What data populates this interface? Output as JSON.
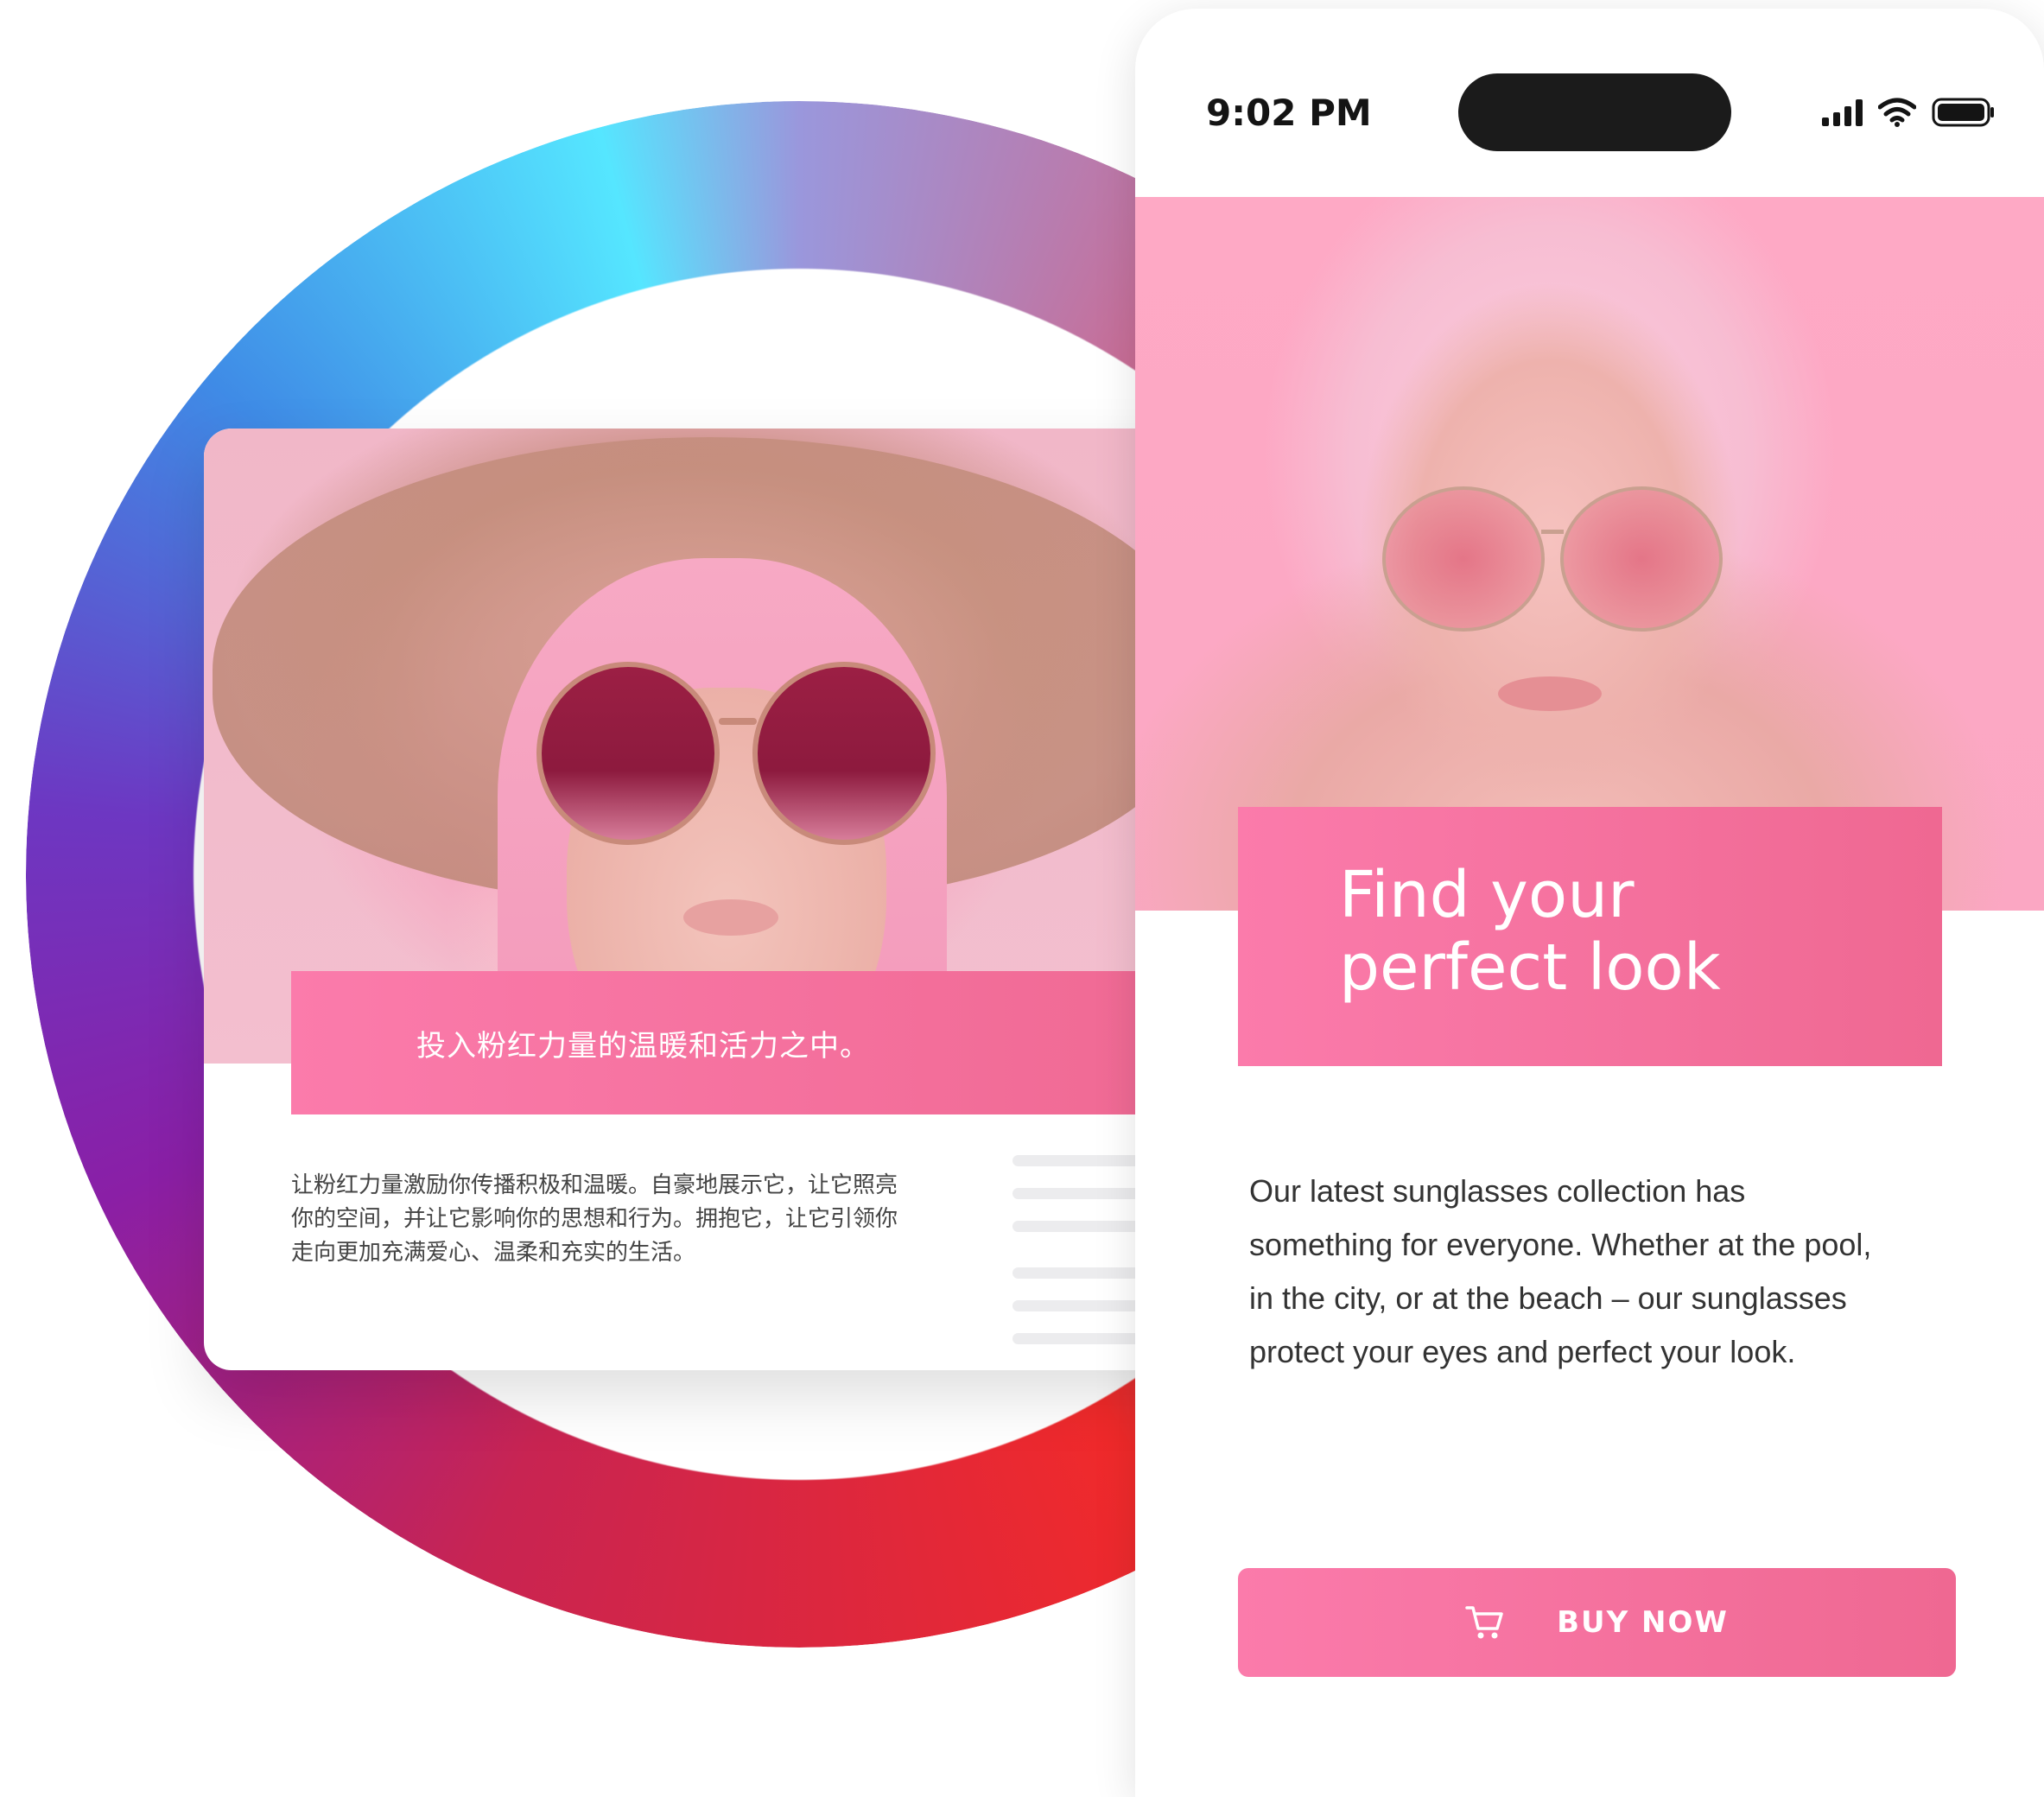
{
  "left_card": {
    "banner_text": "投入粉红力量的温暖和活力之中。",
    "body_lines": [
      "让粉红力量激励你传播积极和温暖。自豪地展示它，让它照亮",
      "你的空间，并让它影响你的思想和行为。拥抱它，让它引领你",
      "走向更加充满爱心、温柔和充实的生活。"
    ]
  },
  "phone": {
    "status_bar": {
      "time": "9:02 PM",
      "icons": [
        "signal-icon",
        "wifi-icon",
        "battery-icon"
      ]
    },
    "hero": {
      "title_lines": [
        "Find your",
        "perfect look"
      ]
    },
    "body_lines": [
      "Our latest sunglasses collection has",
      "something for everyone. Whether at the pool,",
      "in the city, or at the beach – our sunglasses",
      "protect your eyes and perfect your look."
    ],
    "cta": {
      "label": "BUY NOW",
      "icon": "cart-icon"
    }
  },
  "colors": {
    "accent_pink": "#fb7bab",
    "accent_pink_dark": "#ef6892",
    "hero_background": "#fea9c5",
    "ring_gradient": [
      "#55e6ff",
      "#3f8be6",
      "#6d37c2",
      "#8a1fa6",
      "#c82452",
      "#f12a2a",
      "#9a97dc"
    ]
  }
}
